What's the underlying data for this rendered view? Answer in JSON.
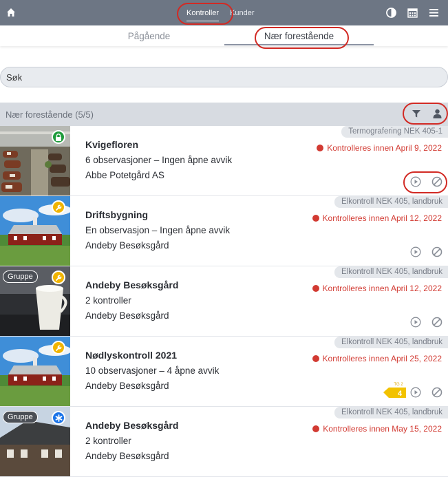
{
  "topbar": {
    "tabs": [
      {
        "label": "Kontroller",
        "active": true
      },
      {
        "label": "Kunder",
        "active": false
      }
    ],
    "icons": [
      "home-icon",
      "contrast-icon",
      "calendar-icon",
      "menu-icon"
    ]
  },
  "segments": {
    "items": [
      "Pågående",
      "Nær forestående"
    ],
    "selected": "Nær forestående"
  },
  "search": {
    "placeholder": "Søk"
  },
  "section": {
    "title": "Nær forestående (5/5)"
  },
  "colors": {
    "topbar": "#6d7684",
    "due_red": "#d23a32",
    "annotation_red": "#d22a24",
    "badge_green": "#1f9b3c",
    "badge_yellow": "#f0b400",
    "badge_blue": "#1a73e8"
  },
  "items": [
    {
      "name": "Kvigefloren",
      "line2": "6 observasjoner – Ingen åpne avvik",
      "line3": "Abbe Potetgård AS",
      "control_type": "Termografering NEK 405-1",
      "due": "Kontrolleres innen April 9, 2022",
      "badge": "lock-icon"
    },
    {
      "name": "Driftsbygning",
      "line2": "En observasjon – Ingen åpne avvik",
      "line3": "Andeby Besøksgård",
      "control_type": "Elkontroll NEK 405, landbruk",
      "due": "Kontrolleres innen April 12, 2022",
      "badge": "wrench-icon"
    },
    {
      "name": "Andeby Besøksgård",
      "line2": "2 kontroller",
      "line3": "Andeby Besøksgård",
      "control_type": "Elkontroll NEK 405, landbruk",
      "due": "Kontrolleres innen April 12, 2022",
      "badge": "wrench-icon",
      "group_label": "Gruppe"
    },
    {
      "name": "Nødlyskontroll 2021",
      "line2": "10 observasjoner – 4 åpne avvik",
      "line3": "Andeby Besøksgård",
      "control_type": "Elkontroll NEK 405, landbruk",
      "due": "Kontrolleres innen April 25, 2022",
      "badge": "wrench-icon",
      "tg_label": "TG 2",
      "tg_count": "4"
    },
    {
      "name": "Andeby Besøksgård",
      "line2": "2 kontroller",
      "line3": "Andeby Besøksgård",
      "control_type": "Elkontroll NEK 405, landbruk",
      "due": "Kontrolleres innen May 15, 2022",
      "badge": "asterisk-icon",
      "group_label": "Gruppe"
    }
  ]
}
